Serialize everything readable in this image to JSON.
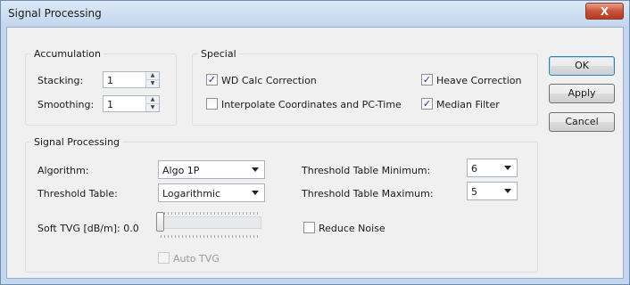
{
  "window": {
    "title": "Signal Processing",
    "close_glyph": "X"
  },
  "accumulation": {
    "label": "Accumulation",
    "stacking": {
      "label": "Stacking:",
      "value": "1"
    },
    "smoothing": {
      "label": "Smoothing:",
      "value": "1"
    }
  },
  "special": {
    "label": "Special",
    "wd_calc": {
      "label": "WD Calc Correction",
      "checked": true
    },
    "heave": {
      "label": "Heave Correction",
      "checked": true
    },
    "interpolate": {
      "label": "Interpolate Coordinates and PC-Time",
      "checked": false
    },
    "median": {
      "label": "Median Filter",
      "checked": true
    }
  },
  "signal_processing": {
    "label": "Signal Processing",
    "algorithm": {
      "label": "Algorithm:",
      "value": "Algo 1P"
    },
    "threshold_table": {
      "label": "Threshold Table:",
      "value": "Logarithmic"
    },
    "threshold_min": {
      "label": "Threshold Table Minimum:",
      "value": "6"
    },
    "threshold_max": {
      "label": "Threshold Table Maximum:",
      "value": "5"
    },
    "soft_tvg": {
      "label": "Soft TVG [dB/m]: 0.0",
      "level": 0
    },
    "reduce_noise": {
      "label": "Reduce Noise",
      "checked": false
    },
    "auto_tvg": {
      "label": "Auto TVG",
      "checked": false,
      "disabled": true
    }
  },
  "buttons": {
    "ok": "OK",
    "apply": "Apply",
    "cancel": "Cancel"
  },
  "glyphs": {
    "check": "✓",
    "up": "▲",
    "down": "▼"
  },
  "colors": {
    "accent": "#1d3d8f",
    "close_red": "#c9523a",
    "frame": "#c4d7ef"
  }
}
